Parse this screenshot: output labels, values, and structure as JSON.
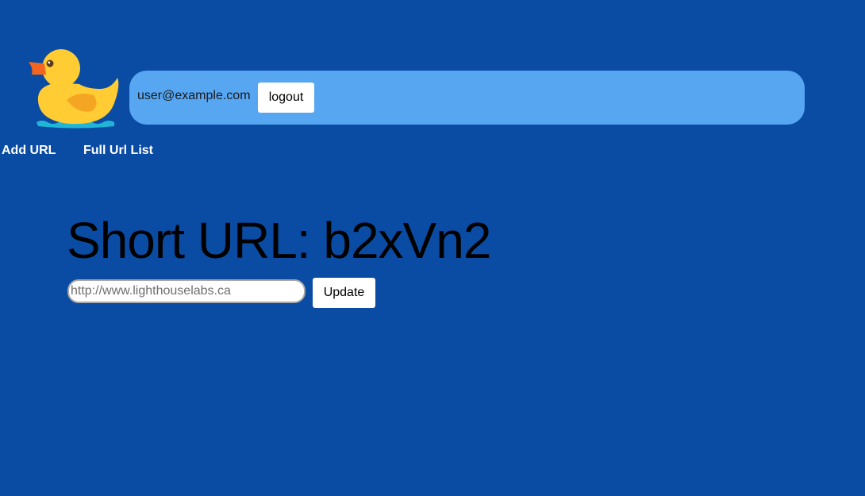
{
  "header": {
    "logo_icon": "rubber-duck-icon",
    "user_email": "user@example.com",
    "logout_label": "logout",
    "userbar_color": "#57a6f2"
  },
  "nav": {
    "add_url_label": "Add URL",
    "url_list_label": "Full Url List"
  },
  "main": {
    "title": "Short URL: b2xVn2",
    "url_input_value": "",
    "url_input_placeholder": "http://www.lighthouselabs.ca",
    "update_label": "Update"
  },
  "theme": {
    "background": "#0a4ca3",
    "duck_body": "#ffcc33",
    "duck_beak": "#f4661f",
    "duck_wing": "#f4a623",
    "water": "#1fb5d6"
  }
}
